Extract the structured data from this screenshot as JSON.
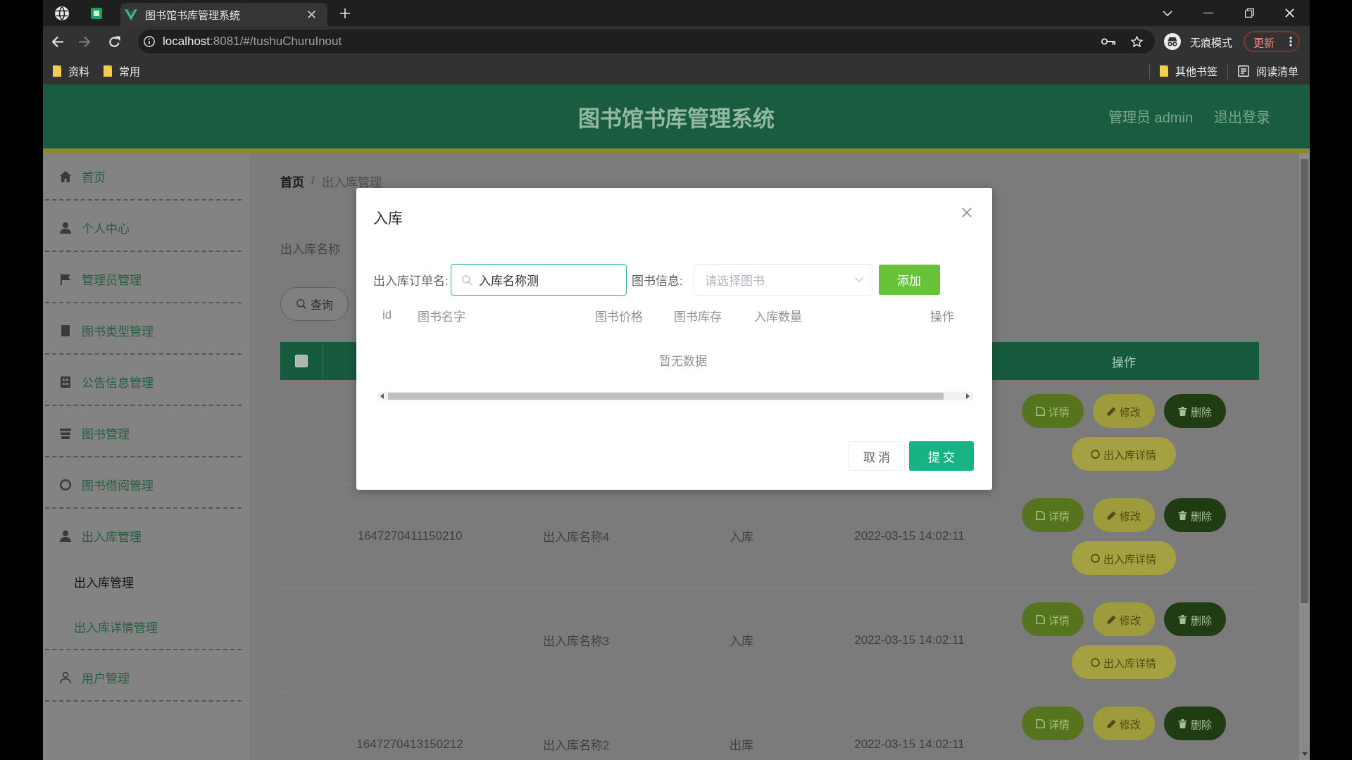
{
  "browser": {
    "tab_title": "图书馆书库管理系统",
    "url": {
      "host": "localhost",
      "path": ":8081/#/tushuChuruInout"
    },
    "profile_label": "无痕模式",
    "update_button": "更新",
    "bookmarks": [
      {
        "kind": "folder",
        "label": "资料"
      },
      {
        "kind": "folder",
        "label": "常用"
      }
    ],
    "bookmarks_right": [
      {
        "kind": "folder",
        "label": "其他书签"
      },
      {
        "kind": "reading-list",
        "label": "阅读清单"
      }
    ]
  },
  "header": {
    "title": "图书馆书库管理系统",
    "user": "管理员 admin",
    "logout": "退出登录"
  },
  "sidebar": {
    "items": [
      {
        "label": "首页"
      },
      {
        "label": "个人中心"
      },
      {
        "label": "管理员管理"
      },
      {
        "label": "图书类型管理"
      },
      {
        "label": "公告信息管理"
      },
      {
        "label": "图书管理"
      },
      {
        "label": "图书借阅管理"
      },
      {
        "label": "出入库管理",
        "children": [
          {
            "label": "出入库管理",
            "selected": true
          },
          {
            "label": "出入库详情管理",
            "selected": false
          }
        ]
      },
      {
        "label": "用户管理"
      }
    ]
  },
  "breadcrumb": {
    "items": [
      "首页",
      "出入库管理"
    ],
    "separator": "/"
  },
  "search": {
    "label": "出入库名称",
    "button": "查询"
  },
  "table": {
    "select_all": {
      "checked": false
    },
    "actions_header": "操作",
    "rows": [
      {
        "actions": [
          {
            "kind": "view",
            "label": "详情"
          },
          {
            "kind": "edit",
            "label": "修改"
          },
          {
            "kind": "delete",
            "label": "删除"
          },
          {
            "kind": "detail",
            "label": "出入库详情"
          }
        ]
      },
      {
        "column_2": "1647270411150210",
        "column_3": "出入库名称4",
        "column_4": "入库",
        "column_5": "2022-03-15 14:02:11",
        "actions": [
          {
            "kind": "view",
            "label": "详情"
          },
          {
            "kind": "edit",
            "label": "修改"
          },
          {
            "kind": "delete",
            "label": "删除"
          },
          {
            "kind": "detail",
            "label": "出入库详情"
          }
        ]
      },
      {
        "column_3": "出入库名称3",
        "column_4": "入库",
        "column_5": "2022-03-15 14:02:11",
        "actions": [
          {
            "kind": "view",
            "label": "详情"
          },
          {
            "kind": "edit",
            "label": "修改"
          },
          {
            "kind": "delete",
            "label": "删除"
          },
          {
            "kind": "detail",
            "label": "出入库详情"
          }
        ]
      },
      {
        "column_2": "1647270413150212",
        "column_3": "出入库名称2",
        "column_4": "出库",
        "column_5": "2022-03-15 14:02:11",
        "actions": [
          {
            "kind": "view",
            "label": "详情"
          },
          {
            "kind": "edit",
            "label": "修改"
          },
          {
            "kind": "delete",
            "label": "删除"
          }
        ]
      }
    ]
  },
  "dialog": {
    "title": "入库",
    "order_label": "出入库订单名:",
    "order_value": "入库名称测",
    "book_label": "图书信息:",
    "book_placeholder": "请选择图书",
    "add_button": "添加",
    "columns": [
      "id",
      "图书名字",
      "图书价格",
      "图书库存",
      "入库数量",
      "操作"
    ],
    "empty_text": "暂无数据",
    "cancel_button": "取 消",
    "submit_button": "提 交"
  }
}
